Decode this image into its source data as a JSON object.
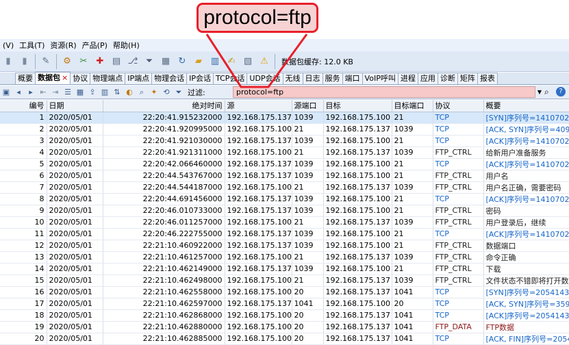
{
  "callout": {
    "text": "protocol=ftp"
  },
  "menu": [
    "(V)",
    "工具(T)",
    "资源(R)",
    "产品(P)",
    "帮助(H)"
  ],
  "toolbar": {
    "icons": [
      "pane-icon",
      "pane-icon",
      "edit-icon",
      "settings-icon",
      "tools-icon",
      "add-icon",
      "doc-icon",
      "network-icon",
      "filter-icon",
      "file-icon",
      "replay-icon",
      "folder-icon",
      "chart-icon",
      "note-icon",
      "report-icon",
      "warning-icon"
    ],
    "buffer_label": "数据包缓存: 12.0 KB"
  },
  "tabs": [
    "概要",
    "数据包",
    "协议",
    "物理端点",
    "IP端点",
    "物理会话",
    "IP会话",
    "TCP会话",
    "UDP会话",
    "无线",
    "日志",
    "服务",
    "端口",
    "VoIP呼叫",
    "进程",
    "应用",
    "诊断",
    "矩阵",
    "报表"
  ],
  "active_tab": "数据包",
  "filter": {
    "label": "过滤:",
    "value": "protocol=ftp"
  },
  "columns": [
    "编号",
    "日期",
    "绝对时间",
    "源",
    "源端口",
    "目标",
    "目标端口",
    "协议",
    "概要"
  ],
  "rows": [
    [
      "1",
      "2020/05/01",
      "22:20:41.915232000",
      "192.168.175.137",
      "1039",
      "192.168.175.100",
      "21",
      "TCP",
      "[SYN]序列号=1410702173,确认号=0,窗"
    ],
    [
      "2",
      "2020/05/01",
      "22:20:41.920995000",
      "192.168.175.100",
      "21",
      "192.168.175.137",
      "1039",
      "TCP",
      "[ACK, SYN]序列号=409420092,确认号=1"
    ],
    [
      "3",
      "2020/05/01",
      "22:20:41.921030000",
      "192.168.175.137",
      "1039",
      "192.168.175.100",
      "21",
      "TCP",
      "[ACK]序列号=1410702174,确认号=40942"
    ],
    [
      "4",
      "2020/05/01",
      "22:20:41.921311000",
      "192.168.175.100",
      "21",
      "192.168.175.137",
      "1039",
      "FTP_CTRL",
      "给新用户准备服务"
    ],
    [
      "5",
      "2020/05/01",
      "22:20:42.066460000",
      "192.168.175.137",
      "1039",
      "192.168.175.100",
      "21",
      "TCP",
      "[ACK]序列号=1410702174,确认号=40942"
    ],
    [
      "6",
      "2020/05/01",
      "22:20:44.543767000",
      "192.168.175.137",
      "1039",
      "192.168.175.100",
      "21",
      "FTP_CTRL",
      "用户名"
    ],
    [
      "7",
      "2020/05/01",
      "22:20:44.544187000",
      "192.168.175.100",
      "21",
      "192.168.175.137",
      "1039",
      "FTP_CTRL",
      "用户名正确，需要密码"
    ],
    [
      "8",
      "2020/05/01",
      "22:20:44.691456000",
      "192.168.175.137",
      "1039",
      "192.168.175.100",
      "21",
      "TCP",
      "[ACK]序列号=1410702190,确认号=40942"
    ],
    [
      "9",
      "2020/05/01",
      "22:20:46.010733000",
      "192.168.175.137",
      "1039",
      "192.168.175.100",
      "21",
      "FTP_CTRL",
      "密码"
    ],
    [
      "10",
      "2020/05/01",
      "22:20:46.011257000",
      "192.168.175.100",
      "21",
      "192.168.175.137",
      "1039",
      "FTP_CTRL",
      "用户登录后，继续"
    ],
    [
      "11",
      "2020/05/01",
      "22:20:46.222755000",
      "192.168.175.137",
      "1039",
      "192.168.175.100",
      "21",
      "TCP",
      "[ACK]序列号=1410702197,确认号=40942"
    ],
    [
      "12",
      "2020/05/01",
      "22:21:10.460922000",
      "192.168.175.137",
      "1039",
      "192.168.175.100",
      "21",
      "FTP_CTRL",
      "数据端口"
    ],
    [
      "13",
      "2020/05/01",
      "22:21:10.461257000",
      "192.168.175.100",
      "21",
      "192.168.175.137",
      "1039",
      "FTP_CTRL",
      "命令正确"
    ],
    [
      "14",
      "2020/05/01",
      "22:21:10.462149000",
      "192.168.175.137",
      "1039",
      "192.168.175.100",
      "21",
      "FTP_CTRL",
      "下载"
    ],
    [
      "15",
      "2020/05/01",
      "22:21:10.462498000",
      "192.168.175.100",
      "21",
      "192.168.175.137",
      "1039",
      "FTP_CTRL",
      "文件状态不错即将打开数据连接"
    ],
    [
      "16",
      "2020/05/01",
      "22:21:10.462558000",
      "192.168.175.100",
      "20",
      "192.168.175.137",
      "1041",
      "TCP",
      "[SYN]序列号=2054143876,确认号=0,窗"
    ],
    [
      "17",
      "2020/05/01",
      "22:21:10.462597000",
      "192.168.175.137",
      "1041",
      "192.168.175.100",
      "20",
      "TCP",
      "[ACK, SYN]序列号=3599850350,确认号="
    ],
    [
      "18",
      "2020/05/01",
      "22:21:10.462868000",
      "192.168.175.100",
      "20",
      "192.168.175.137",
      "1041",
      "TCP",
      "[ACK]序列号=2054143877,确认号=35998"
    ],
    [
      "19",
      "2020/05/01",
      "22:21:10.462880000",
      "192.168.175.100",
      "20",
      "192.168.175.137",
      "1041",
      "FTP_DATA",
      "FTP数据"
    ],
    [
      "20",
      "2020/05/01",
      "22:21:10.462885000",
      "192.168.175.100",
      "20",
      "192.168.175.137",
      "1041",
      "TCP",
      "[ACK, FIN]序列号=2054143886,确认号="
    ]
  ],
  "selected_row": 1,
  "colors": {
    "callout_border": "#e8202a",
    "filter_bg": "#f7c9c9",
    "tcp": "#1565c8",
    "ftp_data": "#8b1a1a"
  }
}
